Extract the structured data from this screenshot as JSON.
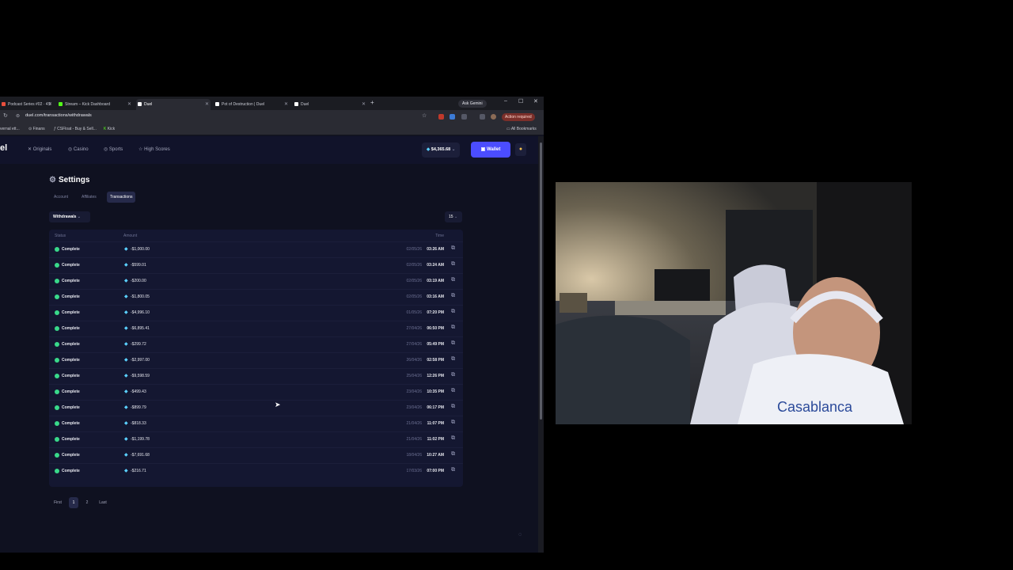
{
  "browser": {
    "tabs": [
      {
        "label": "Podcast Series #02 · 4S",
        "active": false,
        "fav": "#e94f3d"
      },
      {
        "label": "Stream – Kick Dashboard",
        "active": false,
        "fav": "#53fc18"
      },
      {
        "label": "Duel",
        "active": true,
        "fav": "#ffffff"
      },
      {
        "label": "Pot of Destruction | Duel",
        "active": false,
        "fav": "#ffffff"
      },
      {
        "label": "Duel",
        "active": false,
        "fav": "#ffffff"
      }
    ],
    "new_tab": "+",
    "ask_gemini": "Ask Gemini",
    "url": "duel.com/transactions/withdrawals",
    "action_required": "Action required",
    "bookmarks": [
      {
        "label": "Finans"
      },
      {
        "label": "CSFloat - Buy & Sell..."
      },
      {
        "label": "Kick"
      },
      {
        "label": "All Bookmarks"
      }
    ],
    "bookmark_left_fragment": "vernal ett..."
  },
  "site": {
    "logo": "el",
    "nav": [
      {
        "icon": "✕",
        "label": "Originals"
      },
      {
        "icon": "◎",
        "label": "Casino"
      },
      {
        "icon": "◎",
        "label": "Sports"
      },
      {
        "icon": "☆",
        "label": "High Scores"
      }
    ],
    "balance": "$4,365.68",
    "wallet_label": "Wallet",
    "settings_title": "Settings",
    "settings_tabs": [
      {
        "label": "Account",
        "active": false
      },
      {
        "label": "Affiliates",
        "active": false
      },
      {
        "label": "Transactions",
        "active": true
      }
    ],
    "filter_label": "Withdrawals",
    "per_page": "15",
    "table": {
      "headers": {
        "status": "Status",
        "amount": "Amount",
        "time": "Time"
      },
      "rows": [
        {
          "status": "Complete",
          "amount": "-$1,000.00",
          "date": "02/05/26",
          "time": "03:26 AM"
        },
        {
          "status": "Complete",
          "amount": "-$599.01",
          "date": "02/05/26",
          "time": "03:24 AM"
        },
        {
          "status": "Complete",
          "amount": "-$200.00",
          "date": "02/05/26",
          "time": "03:19 AM"
        },
        {
          "status": "Complete",
          "amount": "-$1,800.05",
          "date": "02/05/26",
          "time": "03:16 AM"
        },
        {
          "status": "Complete",
          "amount": "-$4,996.10",
          "date": "01/05/26",
          "time": "07:20 PM"
        },
        {
          "status": "Complete",
          "amount": "-$6,895.41",
          "date": "27/04/26",
          "time": "06:50 PM"
        },
        {
          "status": "Complete",
          "amount": "-$299.72",
          "date": "27/04/26",
          "time": "05:49 PM"
        },
        {
          "status": "Complete",
          "amount": "-$2,997.00",
          "date": "26/04/26",
          "time": "02:58 PM"
        },
        {
          "status": "Complete",
          "amount": "-$9,598.59",
          "date": "25/04/26",
          "time": "12:26 PM"
        },
        {
          "status": "Complete",
          "amount": "-$499.43",
          "date": "23/04/26",
          "time": "10:35 PM"
        },
        {
          "status": "Complete",
          "amount": "-$899.79",
          "date": "23/04/26",
          "time": "06:17 PM"
        },
        {
          "status": "Complete",
          "amount": "-$818.33",
          "date": "21/04/26",
          "time": "11:07 PM"
        },
        {
          "status": "Complete",
          "amount": "-$1,199.78",
          "date": "21/04/26",
          "time": "11:02 PM"
        },
        {
          "status": "Complete",
          "amount": "-$7,691.68",
          "date": "18/04/26",
          "time": "10:27 AM"
        },
        {
          "status": "Complete",
          "amount": "-$216.71",
          "date": "17/03/26",
          "time": "07:00 PM"
        }
      ]
    },
    "pagination": {
      "first": "First",
      "pages": [
        "1",
        "2"
      ],
      "current": "1",
      "last": "Last"
    }
  },
  "colors": {
    "accent": "#4b4dff",
    "status_complete": "#39d98a",
    "gem": "#5ad1ff"
  },
  "icons": {
    "gear": "gear-icon",
    "gem": "gem-icon",
    "external_link": "external-link-icon",
    "user": "user-icon"
  }
}
